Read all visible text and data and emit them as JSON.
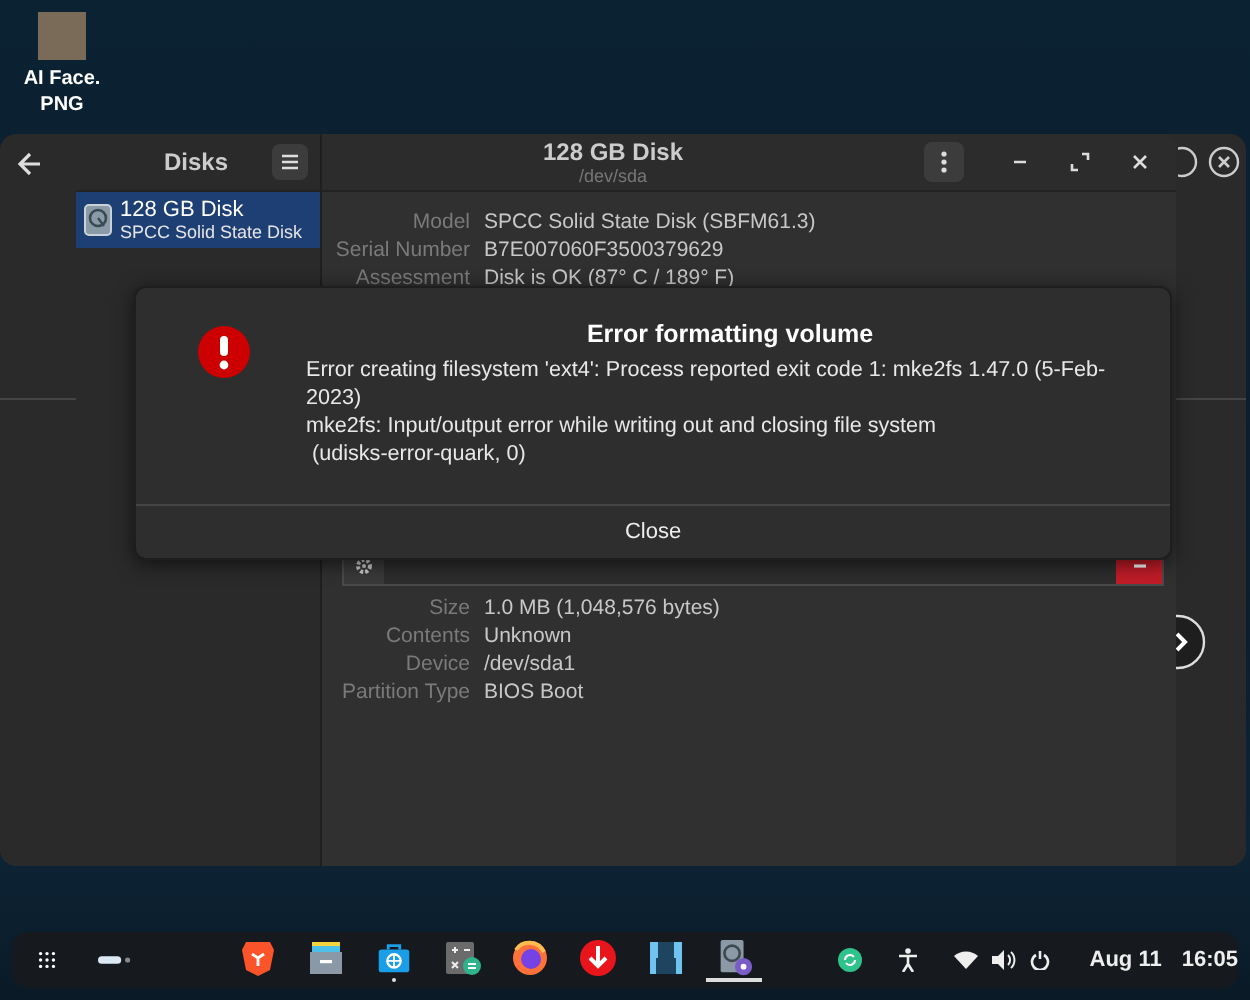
{
  "desktop_icons": [
    {
      "label": "AI Face. PNG"
    }
  ],
  "disks_window": {
    "sidebar_title": "Disks",
    "drives": [
      {
        "name": "128 GB Disk",
        "subtitle": "SPCC Solid State Disk",
        "selected": true
      }
    ],
    "title": "128 GB Disk",
    "subtitle": "/dev/sda",
    "drive_info": [
      {
        "label": "Model",
        "value": "SPCC Solid State Disk (SBFM61.3)"
      },
      {
        "label": "Serial Number",
        "value": "B7E007060F3500379629"
      },
      {
        "label": "Assessment",
        "value": "Disk is OK (87° C / 189° F)"
      }
    ],
    "volume_info": [
      {
        "label": "Size",
        "value": "1.0 MB (1,048,576 bytes)"
      },
      {
        "label": "Contents",
        "value": "Unknown"
      },
      {
        "label": "Device",
        "value": "/dev/sda1"
      },
      {
        "label": "Partition Type",
        "value": "BIOS Boot"
      }
    ]
  },
  "dialog": {
    "title": "Error formatting volume",
    "message": [
      "Error creating filesystem 'ext4': Process reported exit code 1: mke2fs 1.47.0 (5-Feb-2023)",
      "mke2fs: Input/output error while writing out and closing file system",
      " (udisks-error-quark, 0)"
    ],
    "button": "Close"
  },
  "taskbar": {
    "apps": [
      {
        "kind": "browser",
        "running": false,
        "focused": false
      },
      {
        "kind": "files",
        "running": false,
        "focused": false
      },
      {
        "kind": "store",
        "running": true,
        "focused": false
      },
      {
        "kind": "calculator",
        "running": false,
        "focused": false
      },
      {
        "kind": "firefox",
        "running": false,
        "focused": false
      },
      {
        "kind": "download",
        "running": false,
        "focused": false
      },
      {
        "kind": "usb",
        "running": false,
        "focused": false
      },
      {
        "kind": "disks",
        "running": true,
        "focused": true
      }
    ],
    "date": "Aug 11",
    "time": "16:05"
  }
}
